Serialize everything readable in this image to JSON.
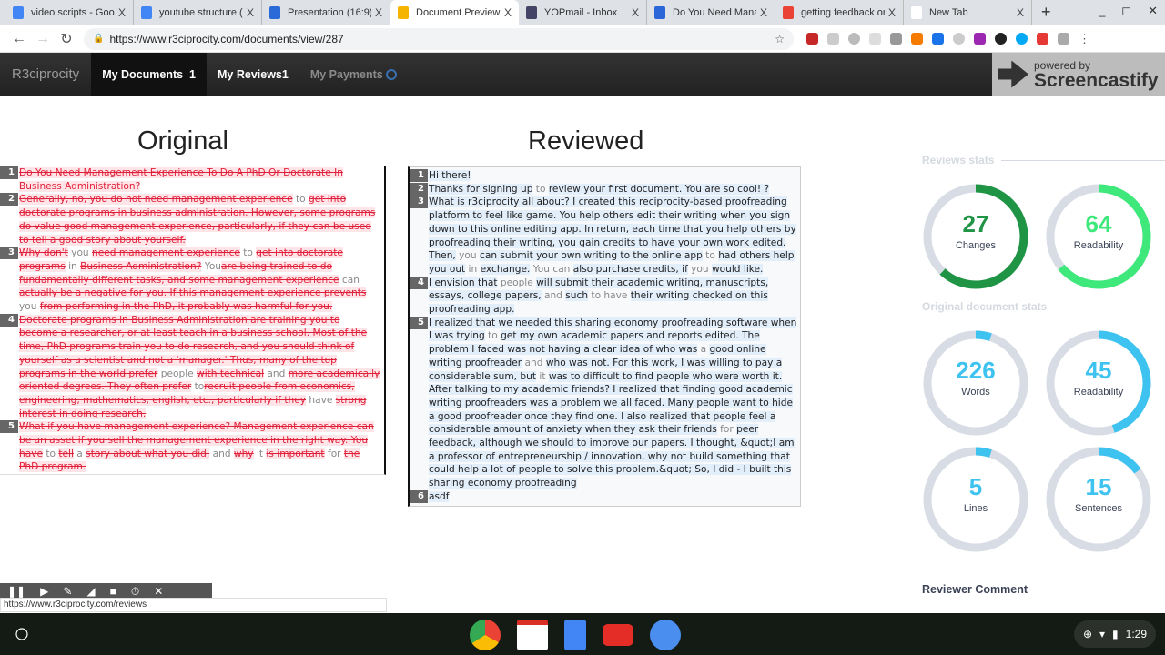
{
  "browser": {
    "tabs": [
      {
        "label": "video scripts - Goog",
        "color": "#4285f4"
      },
      {
        "label": "youtube structure (",
        "color": "#4285f4"
      },
      {
        "label": "Presentation (16:9)",
        "color": "#2a6ad8"
      },
      {
        "label": "Document Preview",
        "color": "#f4b400",
        "active": true
      },
      {
        "label": "YOPmail - Inbox",
        "color": "#444466"
      },
      {
        "label": "Do You Need Mana",
        "color": "#2b66d9"
      },
      {
        "label": "getting feedback on",
        "color": "#ea4335"
      },
      {
        "label": "New Tab",
        "color": "#ffffff"
      }
    ],
    "close_glyph": "X",
    "new_tab": "+",
    "url": "https://www.r3ciprocity.com/documents/view/287",
    "status_url": "https://www.r3ciprocity.com/reviews"
  },
  "app": {
    "brand": "R3ciprocity",
    "nav": [
      {
        "label": "My Documents",
        "badge": "1"
      },
      {
        "label": "My Reviews",
        "badge": "1"
      },
      {
        "label": "My Payments",
        "badge": ""
      }
    ],
    "overlay": {
      "line1": "powered by",
      "line2": "Screencastify"
    }
  },
  "original": {
    "title": "Original",
    "lines": [
      {
        "n": "1",
        "segs": [
          [
            "Do You Need Management Experience To Do A PhD Or Doctorate In Business Administration?",
            1
          ]
        ]
      },
      {
        "n": "2",
        "segs": [
          [
            "Generally, no, you do not need management experience",
            1
          ],
          [
            " to ",
            0
          ],
          [
            "get into doctorate programs in business administration. However, some programs do value good management experience, particularly, if they can be used to tell a good story about yourself.",
            1
          ]
        ]
      },
      {
        "n": "3",
        "segs": [
          [
            "Why don't",
            1
          ],
          [
            " you ",
            0
          ],
          [
            "need management experience",
            1
          ],
          [
            " to ",
            0
          ],
          [
            "get into doctorate programs",
            1
          ],
          [
            " in ",
            0
          ],
          [
            "Business Administration?",
            1
          ],
          [
            " You",
            0
          ],
          [
            "are being trained to do fundamentally different tasks, and some management experience",
            1
          ],
          [
            " can ",
            0
          ],
          [
            "actually be a negative for you. If this management experience prevents",
            1
          ],
          [
            " you ",
            0
          ],
          [
            "from performing in the PhD, it probably was harmful for you.",
            1
          ]
        ]
      },
      {
        "n": "4",
        "segs": [
          [
            "Doctorate programs in Business Administration are training you to become a researcher, or at least teach in a business school. Most of the time, PhD programs train you to do research, and you should think of yourself as a scientist and not a 'manager.' Thus, many of the top programs in the world prefer",
            1
          ],
          [
            " people ",
            0
          ],
          [
            "with technical",
            1
          ],
          [
            " and ",
            0
          ],
          [
            "more academically oriented degrees. They often prefer",
            1
          ],
          [
            " to",
            0
          ],
          [
            "recruit people from economics, engineering, mathematics, english, etc., particularly if they",
            1
          ],
          [
            " have ",
            0
          ],
          [
            "strong interest in doing research.",
            1
          ]
        ]
      },
      {
        "n": "5",
        "segs": [
          [
            "What if you have management experience? Management experience can be an asset if you sell the management experience in the right way. You have",
            1
          ],
          [
            " to ",
            0
          ],
          [
            "tell",
            1
          ],
          [
            " a ",
            0
          ],
          [
            "story about what you did,",
            1
          ],
          [
            " and ",
            0
          ],
          [
            "why",
            1
          ],
          [
            " it ",
            0
          ],
          [
            "is important",
            1
          ],
          [
            " for ",
            0
          ],
          [
            "the PhD program.",
            1
          ]
        ]
      }
    ]
  },
  "reviewed": {
    "title": "Reviewed",
    "lines": [
      {
        "n": "1",
        "segs": [
          [
            "Hi there!",
            1
          ]
        ]
      },
      {
        "n": "2",
        "segs": [
          [
            "Thanks for signing up",
            1
          ],
          [
            " to ",
            0
          ],
          [
            "review your first document. You are so cool! ?",
            1
          ]
        ]
      },
      {
        "n": "3",
        "segs": [
          [
            "What is r3ciprocity all about? I created this reciprocity-based proofreading platform to feel like game. You help others edit their writing when you sign down to this online editing app. In return, each time that you help others by proofreading their writing, you gain credits to have your own work edited. Then,",
            1
          ],
          [
            " you ",
            0
          ],
          [
            "can submit your own writing to the online app",
            1
          ],
          [
            " to ",
            0
          ],
          [
            "had others help you out",
            1
          ],
          [
            " in ",
            0
          ],
          [
            "exchange.",
            1
          ],
          [
            " You can ",
            0
          ],
          [
            "also purchase credits, if",
            1
          ],
          [
            " you ",
            0
          ],
          [
            "would like.",
            1
          ]
        ]
      },
      {
        "n": "4",
        "segs": [
          [
            "I envision that",
            1
          ],
          [
            " people ",
            0
          ],
          [
            "will submit their academic writing, manuscripts, essays, college papers,",
            1
          ],
          [
            " and ",
            0
          ],
          [
            "such",
            1
          ],
          [
            " to have ",
            0
          ],
          [
            "their writing checked on this proofreading app.",
            1
          ]
        ]
      },
      {
        "n": "5",
        "segs": [
          [
            "I realized that we needed this sharing economy proofreading software when I was trying",
            1
          ],
          [
            " to ",
            0
          ],
          [
            "get my own academic papers and reports edited. The problem I faced was not having a clear idea of who was",
            1
          ],
          [
            " a ",
            0
          ],
          [
            "good online writing proofreader",
            1
          ],
          [
            " and ",
            0
          ],
          [
            "who was not. For this work, I was willing to pay a considerable sum, but",
            1
          ],
          [
            " it ",
            0
          ],
          [
            "was to difficult to find people who were worth it. After talking to my academic friends? I realized that finding good academic writing proofreaders was a problem we all faced. Many people want to hide a good proofreader once they find one. I also realized that people feel a considerable amount of anxiety when they ask their friends",
            1
          ],
          [
            " for ",
            0
          ],
          [
            "peer feedback, although we should to improve our papers. I thought, &quot;I am a professor of entrepreneurship / innovation, why not build something that could help a lot of people to solve this problem.&quot; So, I did - I built this sharing economy proofreading",
            1
          ]
        ]
      },
      {
        "n": "6",
        "segs": [
          [
            "asdf",
            1
          ]
        ]
      }
    ]
  },
  "stats": {
    "reviews_title": "Reviews stats",
    "original_title": "Original document stats",
    "reviews": [
      {
        "value": "27",
        "label": "Changes",
        "fill": 0.62,
        "color": "#1e9444"
      },
      {
        "value": "64",
        "label": "Readability",
        "fill": 0.64,
        "color": "#3ee87a"
      }
    ],
    "original": [
      {
        "value": "226",
        "label": "Words",
        "fill": 0.05,
        "color": "#3ec3f0"
      },
      {
        "value": "45",
        "label": "Readability",
        "fill": 0.45,
        "color": "#3ec3f0"
      },
      {
        "value": "5",
        "label": "Lines",
        "fill": 0.05,
        "color": "#3ec3f0"
      },
      {
        "value": "15",
        "label": "Sentences",
        "fill": 0.15,
        "color": "#3ec3f0"
      }
    ],
    "track_color": "#d8dce5"
  },
  "reviewer_comment": "Reviewer Comment",
  "shelf": {
    "time": "1:29"
  }
}
